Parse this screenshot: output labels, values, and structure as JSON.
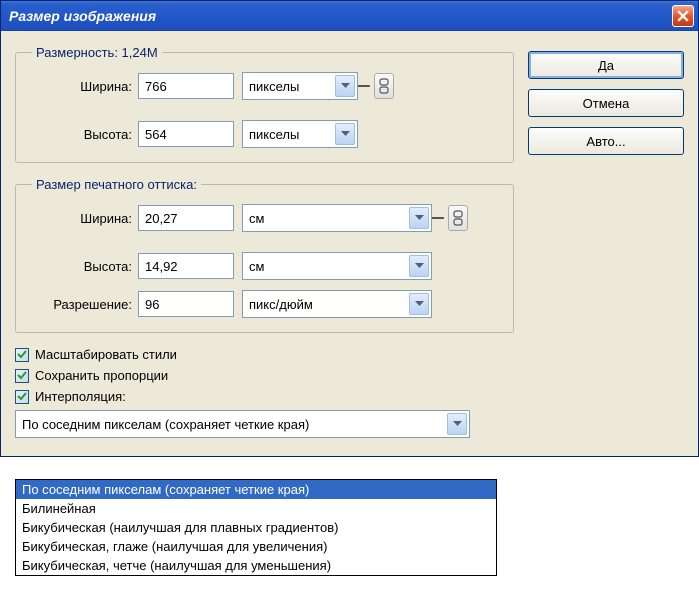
{
  "title": "Размер изображения",
  "buttons": {
    "ok": "Да",
    "cancel": "Отмена",
    "auto": "Авто..."
  },
  "pixelDims": {
    "legend": "Размерность:  1,24M",
    "width_label": "Ширина:",
    "width_value": "766",
    "width_unit": "пикселы",
    "height_label": "Высота:",
    "height_value": "564",
    "height_unit": "пикселы"
  },
  "printSize": {
    "legend": "Размер печатного оттиска:",
    "width_label": "Ширина:",
    "width_value": "20,27",
    "width_unit": "см",
    "height_label": "Высота:",
    "height_value": "14,92",
    "height_unit": "см",
    "res_label": "Разрешение:",
    "res_value": "96",
    "res_unit": "пикс/дюйм"
  },
  "checks": {
    "scale_styles": "Масштабировать стили",
    "constrain": "Сохранить пропорции",
    "interpolation": "Интерполяция:"
  },
  "interp_selected": "По соседним пикселам (сохраняет четкие края)",
  "interp_options": [
    "По соседним пикселам (сохраняет четкие края)",
    "Билинейная",
    "Бикубическая (наилучшая для плавных градиентов)",
    "Бикубическая, глаже (наилучшая для увеличения)",
    "Бикубическая, четче (наилучшая для уменьшения)"
  ]
}
